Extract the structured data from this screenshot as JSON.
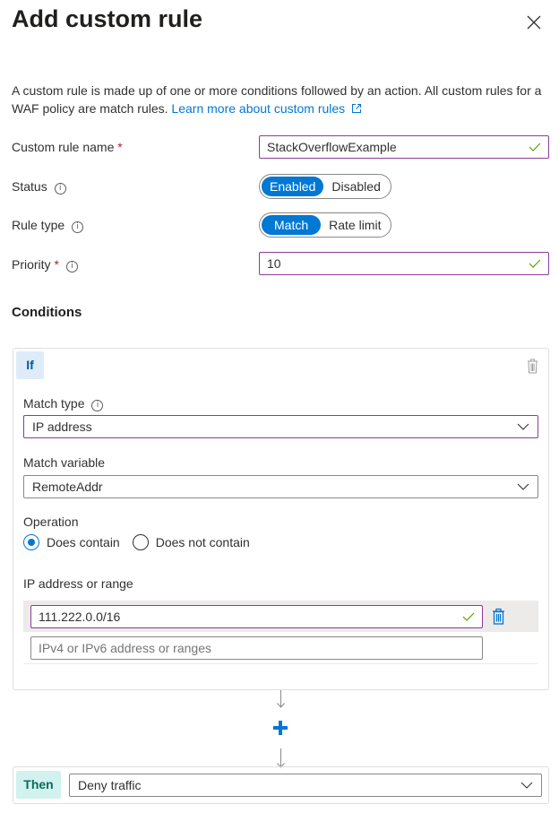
{
  "header": {
    "title": "Add custom rule",
    "close_icon": "close-icon"
  },
  "description": {
    "text": "A custom rule is made up of one or more conditions followed by an action. All custom rules for a WAF policy are match rules.",
    "link_text": "Learn more about custom rules",
    "link_icon": "external-link-icon"
  },
  "form": {
    "rule_name": {
      "label": "Custom rule name",
      "required_mark": "*",
      "value": "StackOverflowExample",
      "valid_icon": "checkmark-icon"
    },
    "status": {
      "label": "Status",
      "info_glyph": "i",
      "options": [
        "Enabled",
        "Disabled"
      ],
      "selected": "Enabled"
    },
    "rule_type": {
      "label": "Rule type",
      "info_glyph": "i",
      "options": [
        "Match",
        "Rate limit"
      ],
      "selected": "Match"
    },
    "priority": {
      "label": "Priority",
      "required_mark": "*",
      "info_glyph": "i",
      "value": "10",
      "valid_icon": "checkmark-icon"
    }
  },
  "conditions": {
    "heading": "Conditions",
    "if_label": "If",
    "match_type": {
      "label": "Match type",
      "info_glyph": "i",
      "value": "IP address"
    },
    "match_variable": {
      "label": "Match variable",
      "value": "RemoteAddr"
    },
    "operation": {
      "label": "Operation",
      "options": [
        "Does contain",
        "Does not contain"
      ],
      "selected": "Does contain"
    },
    "ip_range": {
      "label": "IP address or range",
      "entries": [
        "111.222.0.0/16"
      ],
      "placeholder": "IPv4 or IPv6 address or ranges"
    }
  },
  "add_condition_icon": "plus-icon",
  "action": {
    "then_label": "Then",
    "value": "Deny traffic"
  },
  "colors": {
    "accent": "#0078d4",
    "focus_border": "#8a3c99",
    "valid": "#57a300",
    "required": "#a4262c"
  }
}
